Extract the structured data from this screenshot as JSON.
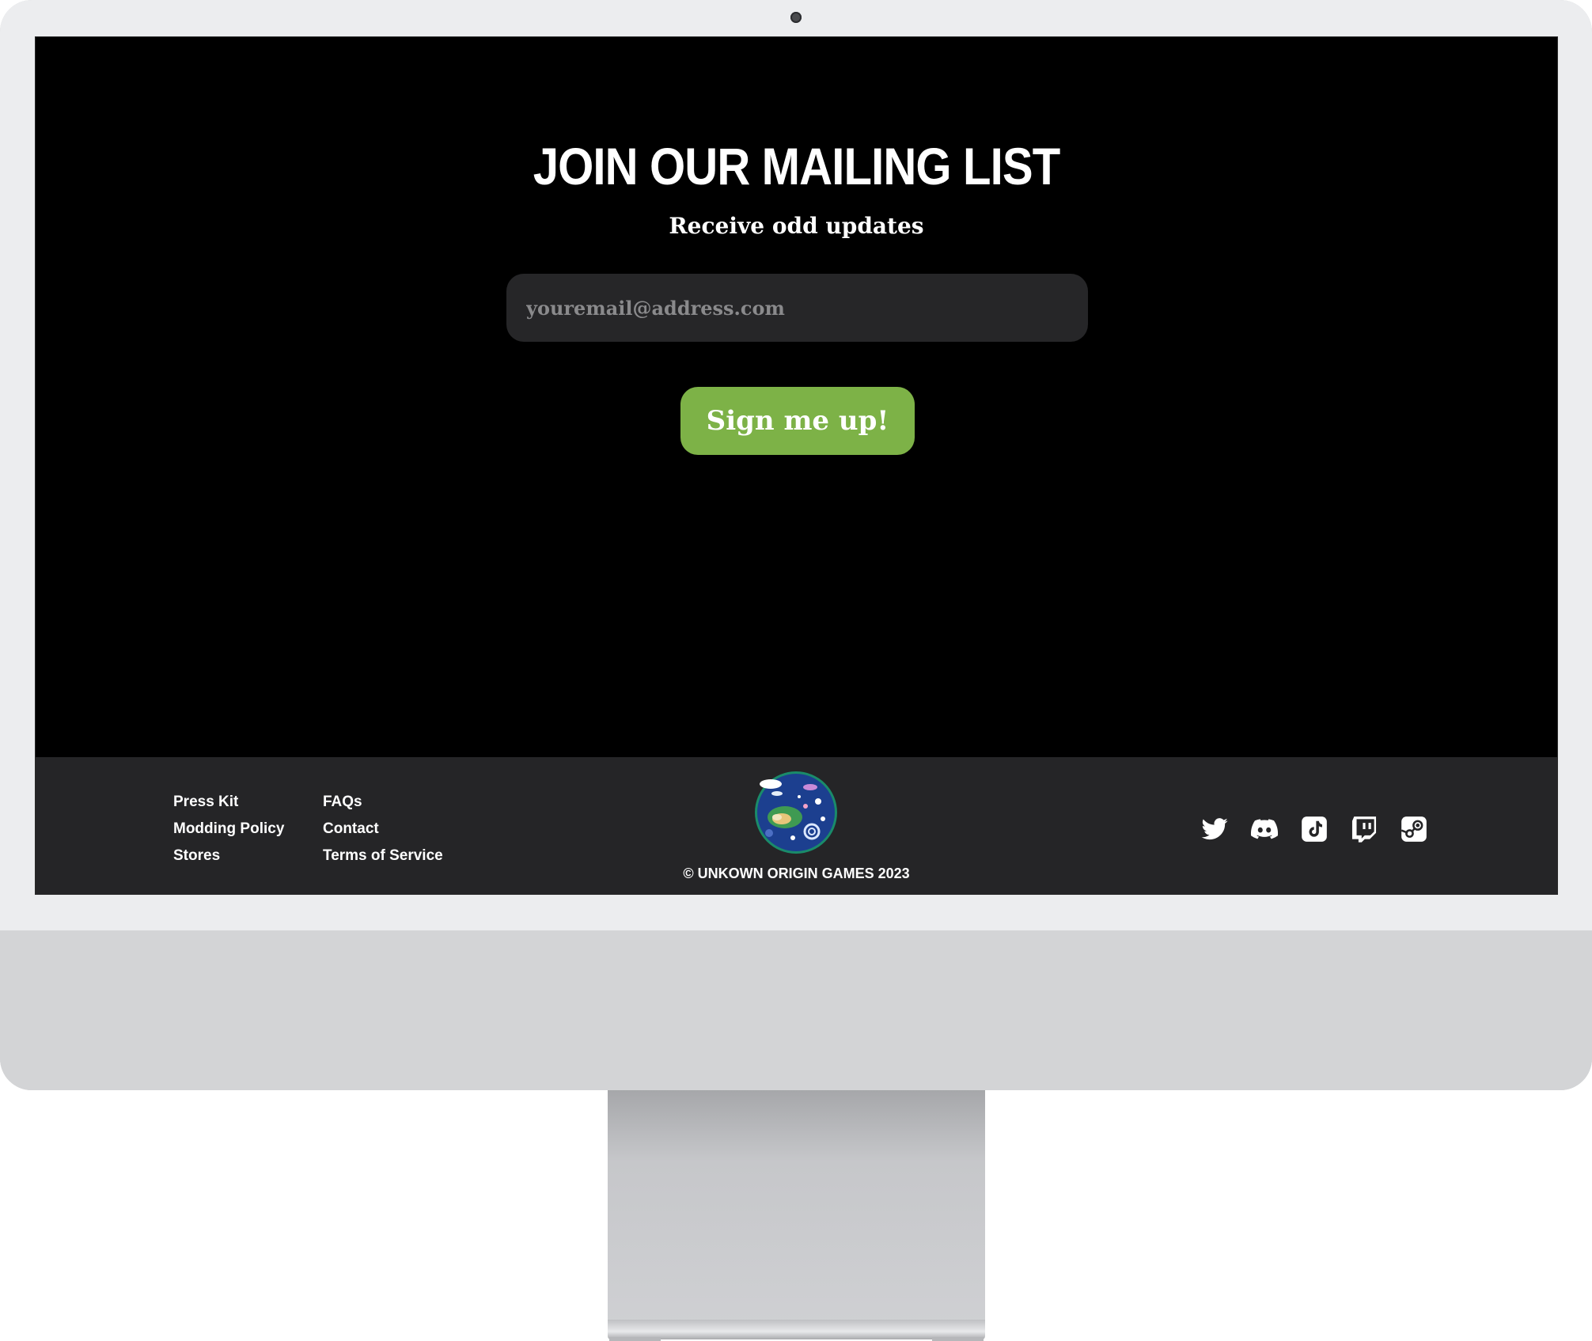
{
  "hero": {
    "title": "JOIN OUR MAILING LIST",
    "subtitle": "Receive odd updates",
    "email_placeholder": "youremail@address.com",
    "signup_label": "Sign me up!"
  },
  "footer": {
    "col1": [
      "Press Kit",
      "Modding Policy",
      "Stores"
    ],
    "col2": [
      "FAQs",
      "Contact",
      "Terms of Service"
    ],
    "copyright": "© UNKOWN ORIGIN GAMES 2023",
    "social_icons": [
      "twitter-icon",
      "discord-icon",
      "tiktok-icon",
      "twitch-icon",
      "steam-icon"
    ]
  },
  "colors": {
    "screen_bg": "#000000",
    "footer_bg": "#252527",
    "input_bg": "#262628",
    "accent_green": "#7db247"
  }
}
